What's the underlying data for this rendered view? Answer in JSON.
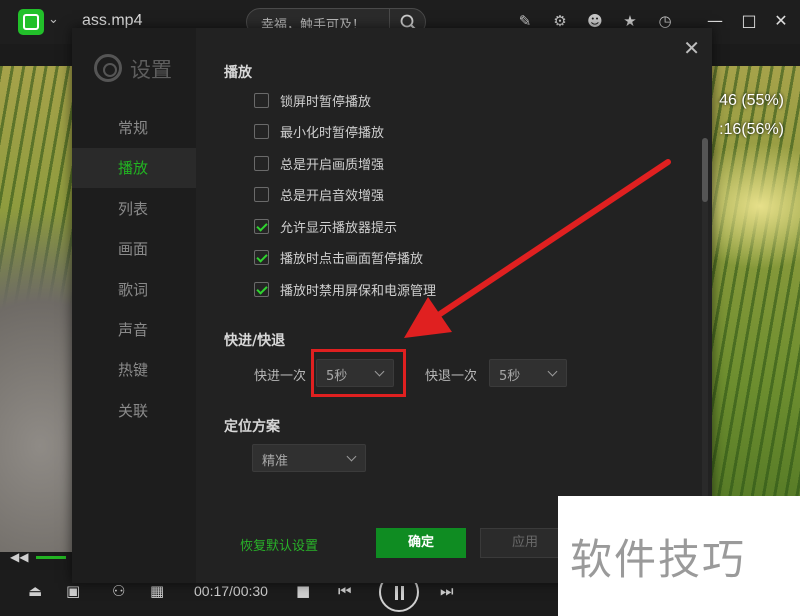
{
  "window": {
    "title": "ass.mp4",
    "search_text": "幸福，触手可及！"
  },
  "video": {
    "time_line_1": "46 (55%)",
    "time_line_2": ":16(56%)"
  },
  "player": {
    "time_display": "00:17/00:30"
  },
  "settings": {
    "header": "设置",
    "nav": [
      "常规",
      "播放",
      "列表",
      "画面",
      "歌词",
      "声音",
      "热键",
      "关联"
    ],
    "active_nav": "播放",
    "playback": {
      "title": "播放",
      "options": [
        {
          "label": "锁屏时暂停播放",
          "checked": false
        },
        {
          "label": "最小化时暂停播放",
          "checked": false
        },
        {
          "label": "总是开启画质增强",
          "checked": false
        },
        {
          "label": "总是开启音效增强",
          "checked": false
        },
        {
          "label": "允许显示播放器提示",
          "checked": true
        },
        {
          "label": "播放时点击画面暂停播放",
          "checked": true
        },
        {
          "label": "播放时禁用屏保和电源管理",
          "checked": true
        }
      ]
    },
    "seek": {
      "title": "快进/快退",
      "forward_label": "快进一次",
      "forward_value": "5秒",
      "backward_label": "快退一次",
      "backward_value": "5秒"
    },
    "positioning": {
      "title": "定位方案",
      "value": "精准"
    },
    "footer": {
      "reset": "恢复默认设置",
      "ok": "确定",
      "apply": "应用"
    }
  },
  "watermark": "软件技巧",
  "colors": {
    "accent_green": "#22b422",
    "ok_button": "#0f8c22",
    "highlight_red": "#e02020"
  }
}
